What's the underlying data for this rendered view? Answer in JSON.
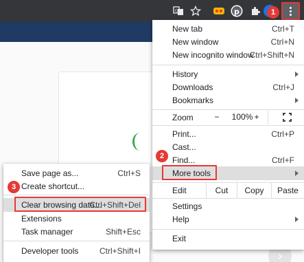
{
  "toolbar": {
    "icons": [
      "translate-icon",
      "star-icon",
      "extension-wizard-icon",
      "pinterest-icon",
      "puzzle-icon",
      "profile-avatar",
      "more-menu-icon"
    ],
    "colors": {
      "bg": "#35363a",
      "highlight": "#e53935"
    }
  },
  "badges": {
    "b1": "1",
    "b2": "2",
    "b3": "3"
  },
  "main_menu": {
    "new_tab": "New tab",
    "new_tab_sc": "Ctrl+T",
    "new_window": "New window",
    "new_window_sc": "Ctrl+N",
    "new_incognito": "New incognito window",
    "new_incognito_sc": "Ctrl+Shift+N",
    "history": "History",
    "downloads": "Downloads",
    "downloads_sc": "Ctrl+J",
    "bookmarks": "Bookmarks",
    "zoom": "Zoom",
    "zoom_minus": "−",
    "zoom_value": "100%",
    "zoom_plus": "+",
    "print": "Print...",
    "print_sc": "Ctrl+P",
    "cast": "Cast...",
    "find": "Find...",
    "find_sc": "Ctrl+F",
    "more_tools": "More tools",
    "edit": "Edit",
    "cut": "Cut",
    "copy": "Copy",
    "paste": "Paste",
    "settings": "Settings",
    "help": "Help",
    "exit": "Exit"
  },
  "sub_menu": {
    "save_page": "Save page as...",
    "save_page_sc": "Ctrl+S",
    "create_shortcut": "Create shortcut...",
    "clear_data": "Clear browsing data...",
    "clear_data_sc": "Ctrl+Shift+Del",
    "extensions": "Extensions",
    "task_manager": "Task manager",
    "task_manager_sc": "Shift+Esc",
    "dev_tools": "Developer tools",
    "dev_tools_sc": "Ctrl+Shift+I"
  },
  "page": {
    "next_arrow": "›"
  }
}
